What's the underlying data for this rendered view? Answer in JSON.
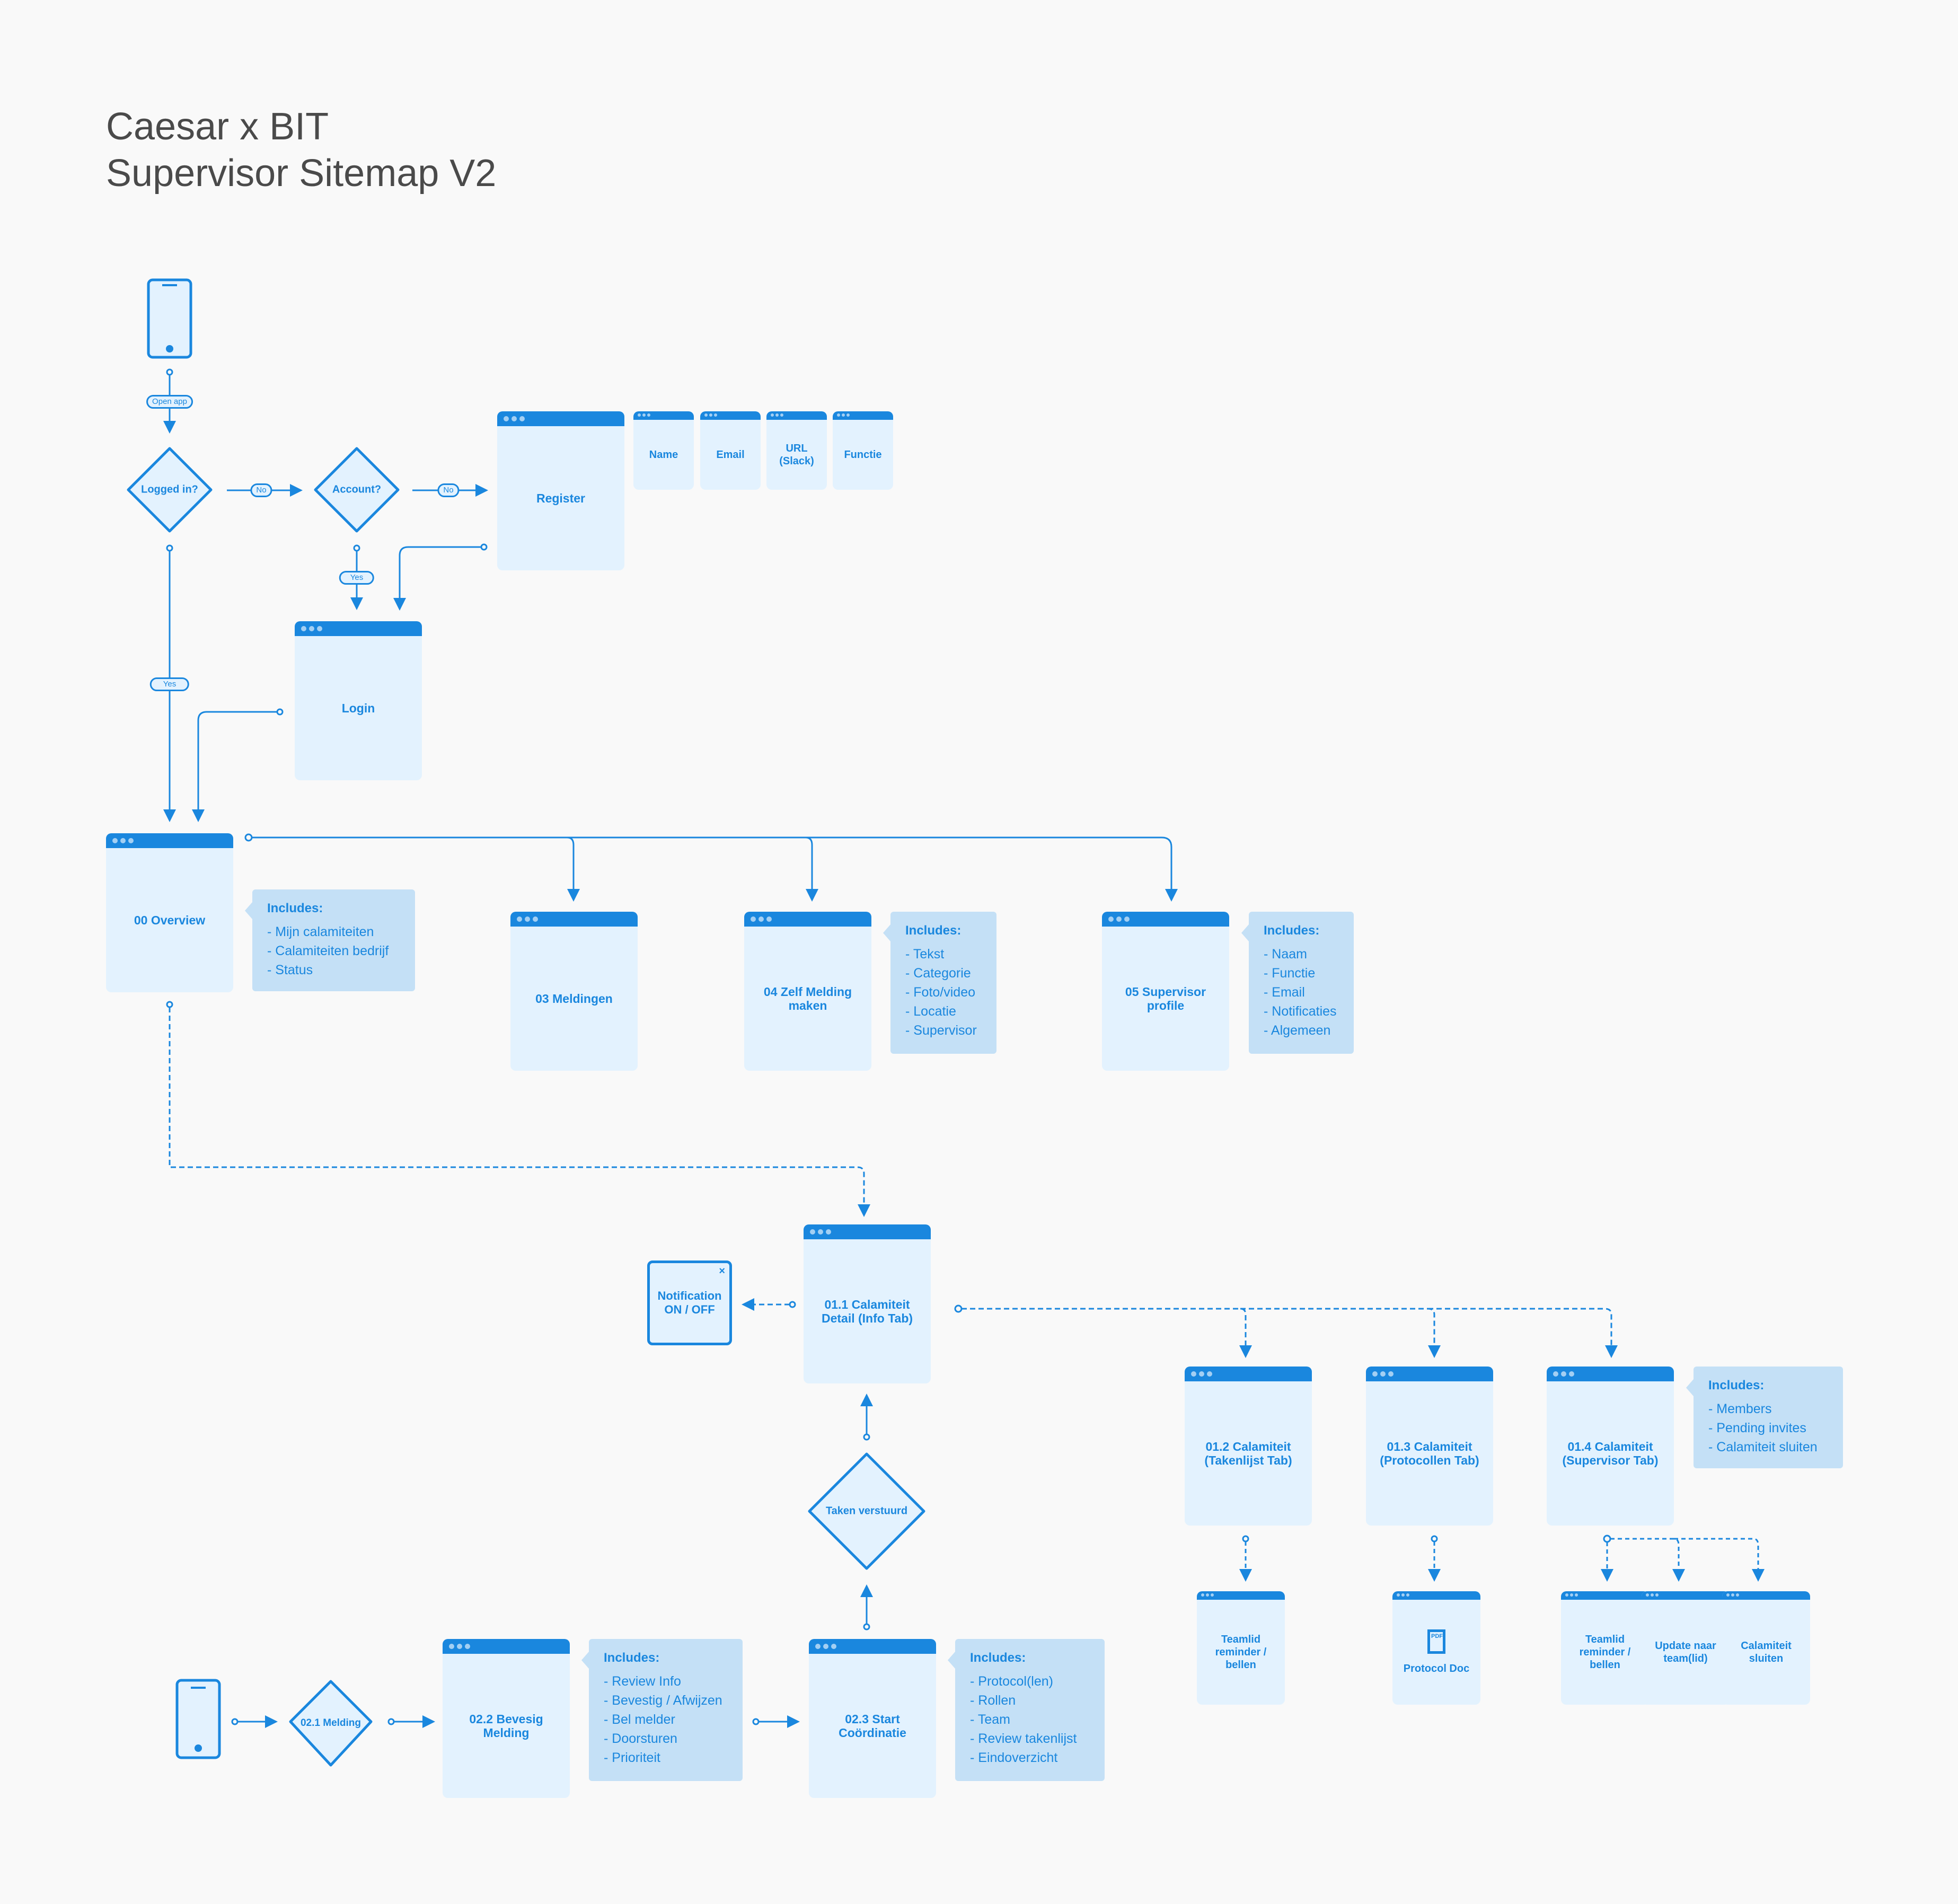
{
  "title": {
    "line1": "Caesar x BIT",
    "line2": "Supervisor Sitemap V2"
  },
  "colors": {
    "accent": "#1a87de",
    "window_fill": "#e3f2fe",
    "note_fill": "#c4e0f6",
    "background": "#f9f9f9",
    "title_text": "#4a4a4a"
  },
  "icons": {
    "phone": "mobile-phone-icon",
    "pdf": "pdf-file-icon",
    "close": "close-icon"
  },
  "decisions": {
    "logged_in": "Logged in?",
    "account": "Account?",
    "taken_verstuurd": "Taken verstuurd",
    "melding": "02.1 Melding"
  },
  "edge_labels": {
    "open_app": "Open app",
    "no1": "No",
    "no2": "No",
    "yes_account": "Yes",
    "yes_logged": "Yes"
  },
  "screens": {
    "register": "Register",
    "register_fields": [
      "Name",
      "Email",
      "URL (Slack)",
      "Functie"
    ],
    "login": "Login",
    "overview": "00 Overview",
    "meldingen": "03 Meldingen",
    "zelf_melding": "04 Zelf Melding maken",
    "supervisor_profile": "05 Supervisor profile",
    "calamiteit_info": "01.1 Calamiteit Detail (Info Tab)",
    "calamiteit_takenlijst": "01.2 Calamiteit (Takenlijst Tab)",
    "calamiteit_protocollen": "01.3 Calamiteit (Protocollen Tab)",
    "calamiteit_supervisor": "01.4 Calamiteit (Supervisor Tab)",
    "bevesig_melding": "02.2 Bevesig Melding",
    "start_coordinatie": "02.3 Start Coördinatie",
    "teamlid_reminder_1": "Teamlid reminder / bellen",
    "protocol_doc": "Protocol Doc",
    "teamlid_reminder_2": "Teamlid reminder / bellen",
    "update_team": "Update naar team(lid)",
    "calamiteit_sluiten": "Calamiteit sluiten"
  },
  "notification": {
    "line1": "Notification",
    "line2": "ON / OFF",
    "close": "×",
    "pdf_label": "PDF"
  },
  "notes": {
    "heading": "Includes:",
    "overview": [
      "- Mijn calamiteiten",
      "- Calamiteiten bedrijf",
      "- Status"
    ],
    "zelf_melding": [
      "- Tekst",
      "- Categorie",
      "- Foto/video",
      "- Locatie",
      "- Supervisor"
    ],
    "supervisor_profile": [
      "- Naam",
      "- Functie",
      "- Email",
      "- Notificaties",
      "- Algemeen"
    ],
    "calamiteit_supervisor": [
      "- Members",
      "- Pending invites",
      "- Calamiteit sluiten"
    ],
    "bevesig_melding": [
      "- Review Info",
      "- Bevestig / Afwijzen",
      "- Bel melder",
      "- Doorsturen",
      "- Prioriteit"
    ],
    "start_coordinatie": [
      "- Protocol(len)",
      "- Rollen",
      "- Team",
      "- Review takenlijst",
      "- Eindoverzicht"
    ]
  }
}
